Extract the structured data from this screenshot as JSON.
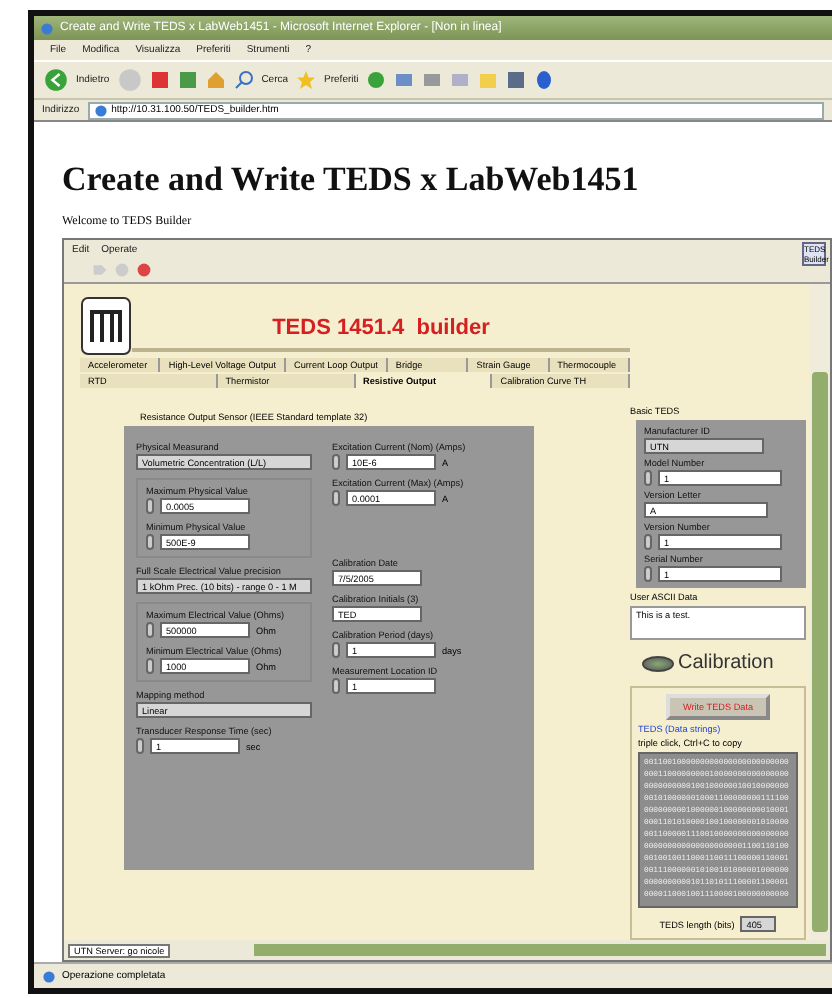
{
  "browser": {
    "title": "Create and Write TEDS x LabWeb1451 - Microsoft Internet Explorer - [Non in linea]",
    "menu": [
      "File",
      "Modifica",
      "Visualizza",
      "Preferiti",
      "Strumenti",
      "?"
    ],
    "toolbar": {
      "back": "Indietro",
      "search": "Cerca",
      "favorites": "Preferiti"
    },
    "address": {
      "label": "Indirizzo",
      "url": "http://10.31.100.50/TEDS_builder.htm"
    },
    "status": "Operazione completata"
  },
  "page": {
    "heading": "Create and Write TEDS x LabWeb1451",
    "welcome": "Welcome to TEDS Builder"
  },
  "vi": {
    "menu": [
      "Edit",
      "Operate"
    ],
    "side_button": "TEDS Builder",
    "title": "TEDS 1451.4  builder",
    "tabs": [
      [
        {
          "label": "Accelerometer",
          "selected": false
        },
        {
          "label": "High-Level Voltage Output",
          "selected": false
        },
        {
          "label": "Current Loop Output",
          "selected": false
        },
        {
          "label": "Bridge",
          "selected": false
        },
        {
          "label": "Strain Gauge",
          "selected": false
        },
        {
          "label": "Thermocouple",
          "selected": false
        }
      ],
      [
        {
          "label": "RTD",
          "selected": false
        },
        {
          "label": "Thermistor",
          "selected": false
        },
        {
          "label": "Resistive Output",
          "selected": true
        },
        {
          "label": "Calibration Curve TH",
          "selected": false
        }
      ]
    ],
    "template_label": "Resistance Output Sensor (IEEE Standard template 32)",
    "left_fields": [
      {
        "kind": "enum",
        "label": "Physical Measurand",
        "value": "Volumetric Concentration (L/L)"
      },
      {
        "kind": "group",
        "fields": [
          {
            "kind": "numeric",
            "label": "Maximum Physical Value",
            "value": "0.0005"
          },
          {
            "kind": "numeric",
            "label": "Minimum Physical Value",
            "value": "500E-9"
          }
        ]
      },
      {
        "kind": "enum",
        "label": "Full Scale Electrical Value precision",
        "value": "1 kOhm Prec. (10 bits) - range 0 - 1 M"
      },
      {
        "kind": "group",
        "fields": [
          {
            "kind": "numeric",
            "label": "Maximum Electrical Value (Ohms)",
            "value": "500000",
            "unit": "Ohm"
          },
          {
            "kind": "numeric",
            "label": "Minimum Electrical Value (Ohms)",
            "value": "1000",
            "unit": "Ohm"
          }
        ]
      },
      {
        "kind": "enum",
        "label": "Mapping method",
        "value": "Linear"
      },
      {
        "kind": "numeric",
        "label": "Transducer Response Time (sec)",
        "value": "1",
        "unit": "sec"
      }
    ],
    "right_fields": [
      {
        "kind": "numeric",
        "label": "Excitation Current (Nom) (Amps)",
        "value": "10E-6",
        "unit": "A"
      },
      {
        "kind": "numeric",
        "label": "Excitation Current (Max) (Amps)",
        "value": "0.0001",
        "unit": "A"
      },
      {
        "kind": "spacer"
      },
      {
        "kind": "text",
        "label": "Calibration Date",
        "value": "7/5/2005"
      },
      {
        "kind": "text",
        "label": "Calibration Initials (3)",
        "value": "TED"
      },
      {
        "kind": "numeric",
        "label": "Calibration Period (days)",
        "value": "1",
        "unit": "days"
      },
      {
        "kind": "numeric",
        "label": "Measurement Location ID",
        "value": "1"
      }
    ],
    "basic_teds": {
      "label": "Basic TEDS",
      "fields": [
        {
          "kind": "enum",
          "label": "Manufacturer ID",
          "value": "UTN"
        },
        {
          "kind": "numeric",
          "label": "Model Number",
          "value": "1"
        },
        {
          "kind": "text",
          "label": "Version Letter",
          "value": "A"
        },
        {
          "kind": "numeric",
          "label": "Version Number",
          "value": "1"
        },
        {
          "kind": "numeric",
          "label": "Serial Number",
          "value": "1"
        }
      ]
    },
    "user_ascii": {
      "label": "User ASCII Data",
      "value": "This is a test."
    },
    "calibration": {
      "label": "Calibration",
      "on": false
    },
    "write_button": "Write TEDS Data",
    "teds_label": "TEDS (Data strings)",
    "teds_hint": "triple click, Ctrl+C to copy",
    "teds_data": [
      "0011001000000000000000000000000",
      "0001100000000010000000000000000",
      "0000000000100100000010010000000",
      "0010100000010001100000000111100",
      "0000000001000000100000000010001",
      "0001101010000100100000001010000",
      "0011000001110010000000000000000",
      "0000000000000000000001100110100",
      "0010010011000110011100000110001",
      "0011100000010100101000001000000",
      "0000000000101101011100001100001",
      "0000110001001110000100000000000"
    ],
    "teds_length": {
      "label": "TEDS length (bits)",
      "value": "405"
    },
    "server": "UTN Server: go nicole"
  }
}
